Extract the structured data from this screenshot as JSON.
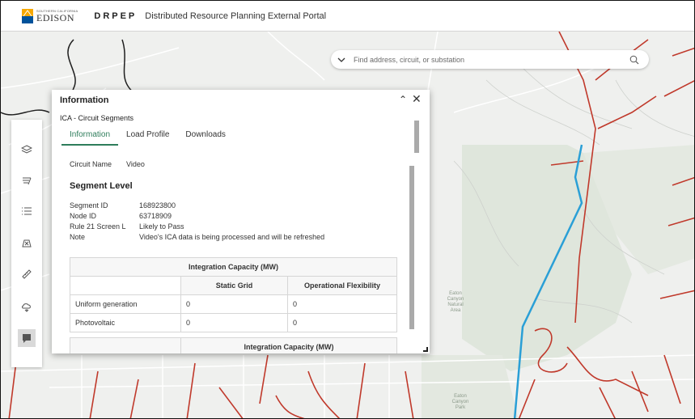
{
  "header": {
    "logo_small": "SOUTHERN CALIFORNIA",
    "logo_word": "EDISON",
    "app_abbr": "DRPEP",
    "app_title": "Distributed Resource Planning External Portal"
  },
  "search": {
    "placeholder": "Find address, circuit, or substation"
  },
  "toolbar": {
    "tools": [
      "layers-icon",
      "legend-icon",
      "list-icon",
      "basemap-icon",
      "measure-icon",
      "weather-icon",
      "info-icon"
    ]
  },
  "panel": {
    "title": "Information",
    "layer_name": "ICA - Circuit Segments",
    "tabs": [
      {
        "label": "Information",
        "active": true
      },
      {
        "label": "Load Profile",
        "active": false
      },
      {
        "label": "Downloads",
        "active": false
      }
    ],
    "circuit_label": "Circuit Name",
    "circuit_value": "Video",
    "segment_heading": "Segment Level",
    "fields": [
      {
        "key": "Segment ID",
        "value": "168923800"
      },
      {
        "key": "Node ID",
        "value": "63718909"
      },
      {
        "key": "Rule 21 Screen L",
        "value": "Likely to Pass"
      },
      {
        "key": "Note",
        "value": "Video's ICA data is being processed and will be refreshed"
      }
    ],
    "table1": {
      "title": "Integration Capacity (MW)",
      "col1": "Static Grid",
      "col2": "Operational Flexibility",
      "rows": [
        {
          "label": "Uniform generation",
          "static": "0",
          "flex": "0"
        },
        {
          "label": "Photovoltaic",
          "static": "0",
          "flex": "0"
        }
      ]
    },
    "table2": {
      "title": "Integration Capacity (MW)"
    }
  },
  "map_labels": {
    "eaton_canyon_area": [
      "Eaton",
      "Canyon",
      "Natural",
      "Area"
    ],
    "eaton_canyon_park": [
      "Eaton",
      "Canyon",
      "Park"
    ]
  },
  "colors": {
    "circuit_red": "#c0392b",
    "selected_blue": "#2a9fd6",
    "tab_green": "#2e7d5b"
  }
}
